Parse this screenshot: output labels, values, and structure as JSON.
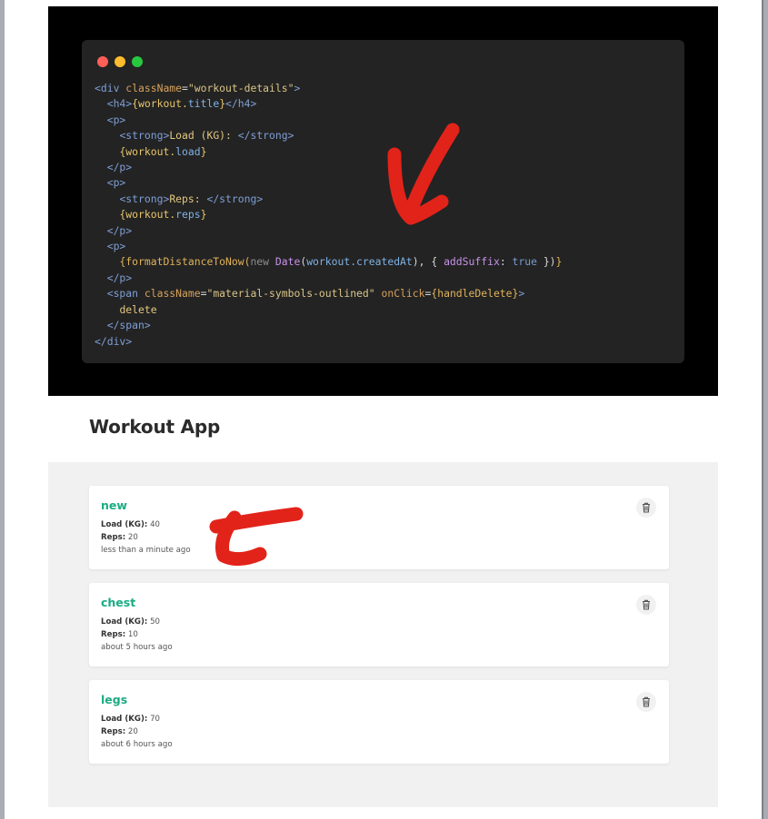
{
  "code_snippet": {
    "lines": [
      [
        [
          "tag",
          "<div "
        ],
        [
          "attr",
          "className"
        ],
        [
          "pun",
          "="
        ],
        [
          "str",
          "\"workout-details\""
        ],
        [
          "tag",
          ">"
        ]
      ],
      [
        [
          "pun",
          "  "
        ],
        [
          "tag",
          "<h4>"
        ],
        [
          "expr",
          "{workout."
        ],
        [
          "prop",
          "title"
        ],
        [
          "expr",
          "}"
        ],
        [
          "tag",
          "</h4>"
        ]
      ],
      [
        [
          "pun",
          "  "
        ],
        [
          "tag",
          "<p>"
        ]
      ],
      [
        [
          "pun",
          "    "
        ],
        [
          "tag",
          "<strong>"
        ],
        [
          "txt",
          "Load (KG): "
        ],
        [
          "tag",
          "</strong>"
        ]
      ],
      [
        [
          "pun",
          "    "
        ],
        [
          "expr",
          "{workout."
        ],
        [
          "prop",
          "load"
        ],
        [
          "expr",
          "}"
        ]
      ],
      [
        [
          "pun",
          "  "
        ],
        [
          "tag",
          "</p>"
        ]
      ],
      [
        [
          "pun",
          "  "
        ],
        [
          "tag",
          "<p>"
        ]
      ],
      [
        [
          "pun",
          "    "
        ],
        [
          "tag",
          "<strong>"
        ],
        [
          "txt",
          "Reps: "
        ],
        [
          "tag",
          "</strong>"
        ]
      ],
      [
        [
          "pun",
          "    "
        ],
        [
          "expr",
          "{workout."
        ],
        [
          "prop",
          "reps"
        ],
        [
          "expr",
          "}"
        ]
      ],
      [
        [
          "pun",
          "  "
        ],
        [
          "tag",
          "</p>"
        ]
      ],
      [
        [
          "pun",
          "  "
        ],
        [
          "tag",
          "<p>"
        ]
      ],
      [
        [
          "pun",
          "    "
        ],
        [
          "fn",
          "{formatDistanceToNow("
        ],
        [
          "kw",
          "new "
        ],
        [
          "cls",
          "Date"
        ],
        [
          "pun",
          "("
        ],
        [
          "prop",
          "workout.createdAt"
        ],
        [
          "pun",
          "), { "
        ],
        [
          "cls",
          "addSuffix"
        ],
        [
          "pun",
          ": "
        ],
        [
          "bool",
          "true"
        ],
        [
          "pun",
          " })"
        ],
        [
          "fn",
          "}"
        ]
      ],
      [
        [
          "pun",
          "  "
        ],
        [
          "tag",
          "</p>"
        ]
      ],
      [
        [
          "pun",
          "  "
        ],
        [
          "tag",
          "<span "
        ],
        [
          "attr",
          "className"
        ],
        [
          "pun",
          "="
        ],
        [
          "str",
          "\"material-symbols-outlined\""
        ],
        [
          "pun",
          " "
        ],
        [
          "attr",
          "onClick"
        ],
        [
          "pun",
          "="
        ],
        [
          "fn",
          "{handleDelete}"
        ],
        [
          "tag",
          ">"
        ]
      ],
      [
        [
          "pun",
          "    "
        ],
        [
          "txt",
          "delete"
        ]
      ],
      [
        [
          "pun",
          "  "
        ],
        [
          "tag",
          "</span>"
        ]
      ],
      [
        [
          "tag",
          "</div>"
        ]
      ]
    ]
  },
  "app": {
    "title": "Workout App"
  },
  "workouts": [
    {
      "title": "new",
      "load_label": "Load (KG):",
      "load": "40",
      "reps_label": "Reps:",
      "reps": "20",
      "time": "less than a minute ago"
    },
    {
      "title": "chest",
      "load_label": "Load (KG):",
      "load": "50",
      "reps_label": "Reps:",
      "reps": "10",
      "time": "about 5 hours ago"
    },
    {
      "title": "legs",
      "load_label": "Load (KG):",
      "load": "70",
      "reps_label": "Reps:",
      "reps": "20",
      "time": "about 6 hours ago"
    }
  ],
  "icons": {
    "delete": "trash-icon"
  },
  "colors": {
    "accent": "#1aac83",
    "annotation": "#e2231a",
    "window_dots": [
      "#ff5f57",
      "#febc2e",
      "#28c840"
    ]
  }
}
